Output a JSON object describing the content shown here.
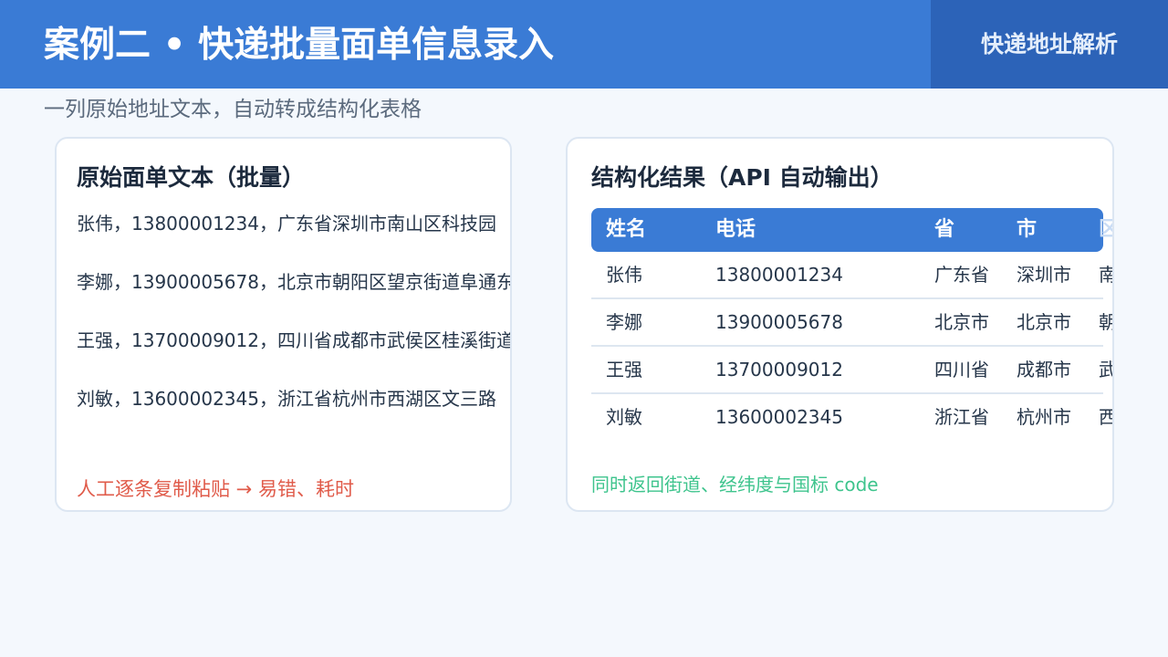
{
  "header": {
    "title": "案例二 • 快递批量面单信息录入",
    "tag": "快递地址解析"
  },
  "subtitle": "一列原始地址文本，自动转成结构化表格",
  "raw_panel": {
    "title": "原始面单文本（批量）",
    "lines": [
      "张伟，13800001234，广东省深圳市南山区科技园",
      "李娜，13900005678，北京市朝阳区望京街道阜通东大街",
      "王强，13700009012，四川省成都市武侯区桂溪街道天府大道",
      "刘敏，13600002345，浙江省杭州市西湖区文三路"
    ],
    "note": "人工逐条复制粘贴 → 易错、耗时"
  },
  "result_panel": {
    "title": "结构化结果（API 自动输出）",
    "columns": [
      "姓名",
      "电话",
      "省",
      "市",
      "区县"
    ],
    "rows": [
      [
        "张伟",
        "13800001234",
        "广东省",
        "深圳市",
        "南山区"
      ],
      [
        "李娜",
        "13900005678",
        "北京市",
        "北京市",
        "朝阳区"
      ],
      [
        "王强",
        "13700009012",
        "四川省",
        "成都市",
        "武侯区"
      ],
      [
        "刘敏",
        "13600002345",
        "浙江省",
        "杭州市",
        "西湖区"
      ]
    ],
    "note": "同时返回街道、经纬度与国标 code"
  },
  "colors": {
    "primary": "#3a7bd5",
    "primary_dark": "#2c63b8",
    "background": "#f4f8fd",
    "warning": "#e05b4a",
    "success": "#3ec48d"
  }
}
